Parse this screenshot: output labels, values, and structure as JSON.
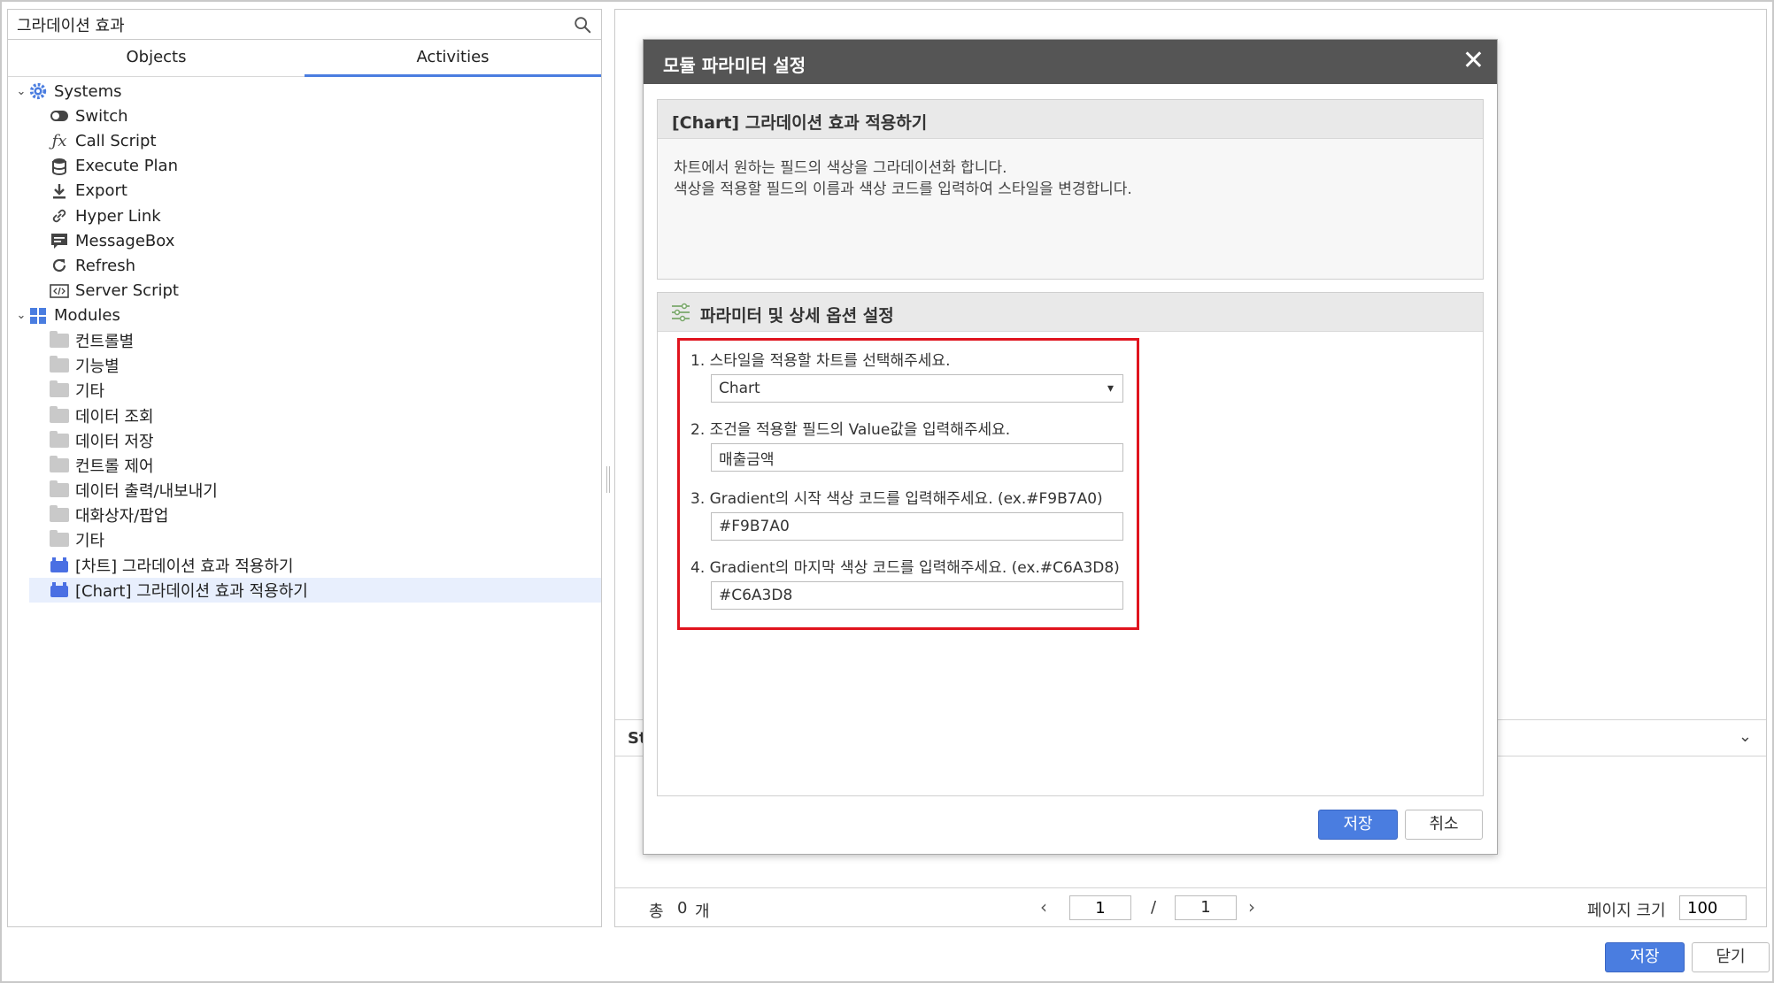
{
  "search": {
    "value": "그라데이션 효과"
  },
  "tabs": {
    "objects": "Objects",
    "activities": "Activities"
  },
  "tree": {
    "systems": {
      "label": "Systems",
      "items": [
        "Switch",
        "Call Script",
        "Execute Plan",
        "Export",
        "Hyper Link",
        "MessageBox",
        "Refresh",
        "Server Script"
      ]
    },
    "modules": {
      "label": "Modules",
      "folders": [
        "컨트롤별",
        "기능별",
        "기타",
        "데이터 조회",
        "데이터 저장",
        "컨트롤 제어",
        "데이터 출력/내보내기",
        "대화상자/팝업",
        "기타"
      ],
      "items": [
        "[차트] 그라데이션 효과 적용하기",
        "[Chart] 그라데이션 효과 적용하기"
      ]
    }
  },
  "background": {
    "strip_label": "St",
    "pager": {
      "total_label": "총",
      "total_value": "0",
      "total_unit": "개",
      "current_page": "1",
      "separator": "/",
      "total_pages": "1",
      "page_size_label": "페이지 크기",
      "page_size": "100"
    }
  },
  "buttons": {
    "save": "저장",
    "close": "닫기"
  },
  "modal": {
    "title": "모듈 파라미터 설정",
    "close_symbol": "✕",
    "info": {
      "title": "[Chart] 그라데이션 효과 적용하기",
      "desc1": "차트에서 원하는 필드의 색상을 그라데이션화 합니다.",
      "desc2": "색상을 적용할 필드의 이름과 색상 코드를 입력하여 스타일을 변경합니다."
    },
    "params": {
      "title": "파라미터 및 상세 옵션 설정",
      "q1": "1. 스타일을 적용할 차트를 선택해주세요.",
      "chart_select": "Chart",
      "q2": "2. 조건을 적용할 필드의 Value값을 입력해주세요.",
      "value_input": "매출금액",
      "q3": "3. Gradient의 시작 색상 코드를 입력해주세요. (ex.#F9B7A0)",
      "start_color": "#F9B7A0",
      "q4": "4. Gradient의 마지막 색상 코드를 입력해주세요.  (ex.#C6A3D8)",
      "end_color": "#C6A3D8"
    },
    "save": "저장",
    "cancel": "취소"
  },
  "colors": {
    "accent": "#4a7de0",
    "header": "#555555",
    "highlight": "#e0141e",
    "selected_row": "#e8effd"
  }
}
